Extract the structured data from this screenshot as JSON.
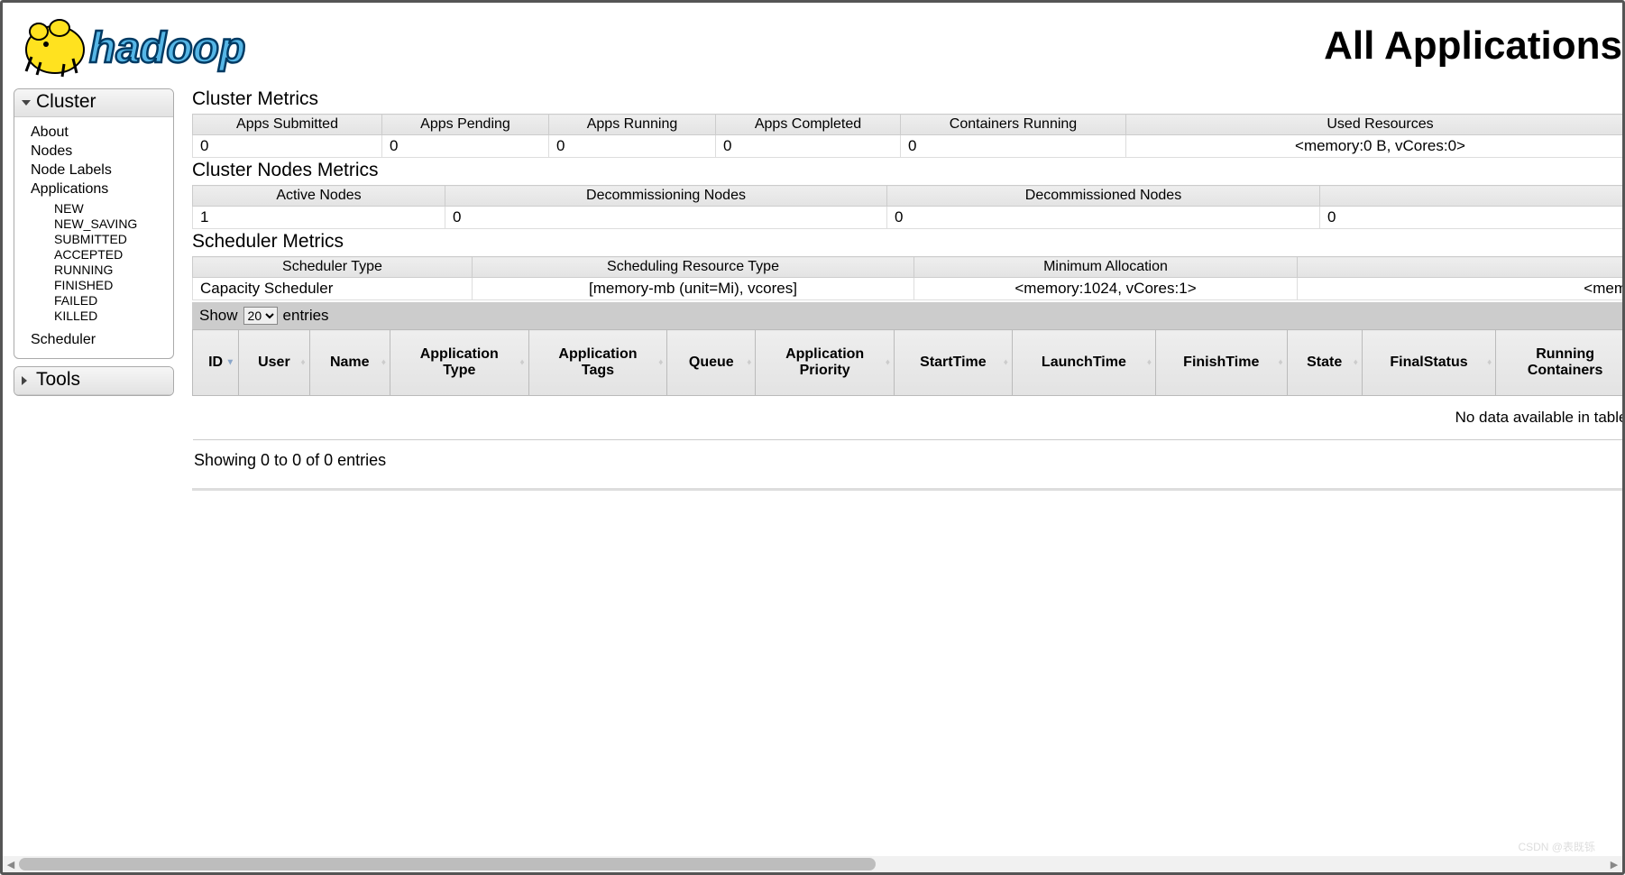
{
  "page_title": "All Applications",
  "logo_text": "hadoop",
  "sidebar": {
    "cluster": {
      "title": "Cluster",
      "items": {
        "about": "About",
        "nodes": "Nodes",
        "node_labels": "Node Labels",
        "applications": "Applications",
        "scheduler": "Scheduler"
      },
      "app_states": {
        "new": "NEW",
        "new_saving": "NEW_SAVING",
        "submitted": "SUBMITTED",
        "accepted": "ACCEPTED",
        "running": "RUNNING",
        "finished": "FINISHED",
        "failed": "FAILED",
        "killed": "KILLED"
      }
    },
    "tools": {
      "title": "Tools"
    }
  },
  "cluster_metrics": {
    "title": "Cluster Metrics",
    "headers": {
      "apps_submitted": "Apps Submitted",
      "apps_pending": "Apps Pending",
      "apps_running": "Apps Running",
      "apps_completed": "Apps Completed",
      "containers_running": "Containers Running",
      "used_resources": "Used Resources"
    },
    "values": {
      "apps_submitted": "0",
      "apps_pending": "0",
      "apps_running": "0",
      "apps_completed": "0",
      "containers_running": "0",
      "used_resources": "<memory:0 B, vCores:0>"
    }
  },
  "cluster_nodes_metrics": {
    "title": "Cluster Nodes Metrics",
    "headers": {
      "active": "Active Nodes",
      "decommissioning": "Decommissioning Nodes",
      "decommissioned": "Decommissioned Nodes"
    },
    "values": {
      "active": "1",
      "decommissioning": "0",
      "decommissioned": "0",
      "extra": "0"
    }
  },
  "scheduler_metrics": {
    "title": "Scheduler Metrics",
    "headers": {
      "type": "Scheduler Type",
      "resource_type": "Scheduling Resource Type",
      "min_alloc": "Minimum Allocation"
    },
    "values": {
      "type": "Capacity Scheduler",
      "resource_type": "[memory-mb (unit=Mi), vcores]",
      "min_alloc": "<memory:1024, vCores:1>",
      "max_alloc_partial": "<mem"
    }
  },
  "datatable": {
    "show_label_pre": "Show",
    "show_label_post": "entries",
    "page_length": "20",
    "columns": {
      "id": "ID",
      "user": "User",
      "name": "Name",
      "app_type": "Application Type",
      "app_tags": "Application Tags",
      "queue": "Queue",
      "app_priority": "Application Priority",
      "start_time": "StartTime",
      "launch_time": "LaunchTime",
      "finish_time": "FinishTime",
      "state": "State",
      "final_status": "FinalStatus",
      "running_containers": "Running Containers"
    },
    "empty": "No data available in table",
    "info": "Showing 0 to 0 of 0 entries"
  },
  "watermark": "CSDN @表既铄"
}
